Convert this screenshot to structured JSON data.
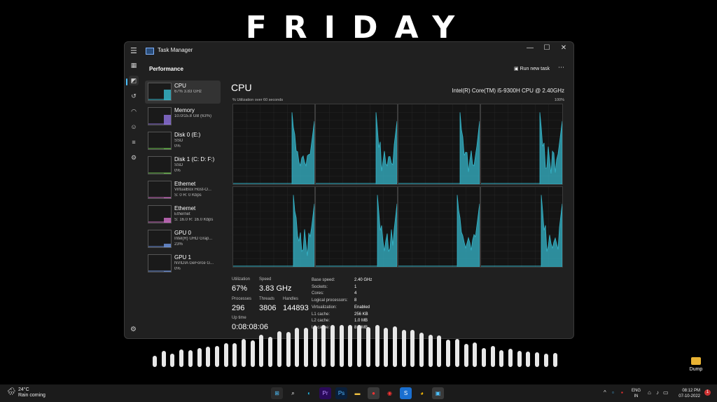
{
  "brand": "FRIDAY",
  "window": {
    "title": "Task Manager",
    "minimize": "—",
    "maximize": "☐",
    "close": "✕"
  },
  "header": {
    "title": "Performance",
    "run_new_task": "Run new task",
    "more": "⋯"
  },
  "devices": [
    {
      "name": "CPU",
      "sub1": "67% 3.83 GHz",
      "sub2": "",
      "color": "#35b5c9",
      "level": 0.67
    },
    {
      "name": "Memory",
      "sub1": "10.0/15.8 GB (63%)",
      "sub2": "",
      "color": "#8a6fd6",
      "level": 0.63
    },
    {
      "name": "Disk 0 (E:)",
      "sub1": "SSD",
      "sub2": "0%",
      "color": "#6cbf4f",
      "level": 0.0
    },
    {
      "name": "Disk 1 (C: D: F:)",
      "sub1": "SSD",
      "sub2": "0%",
      "color": "#6cbf4f",
      "level": 0.0
    },
    {
      "name": "Ethernet",
      "sub1": "VirtualBox Host-O...",
      "sub2": "S: 0 R: 0 Kbps",
      "color": "#c86bbf",
      "level": 0.0
    },
    {
      "name": "Ethernet",
      "sub1": "Ethernet",
      "sub2": "S: 16.0 R: 16.0 Kbps",
      "color": "#c86bbf",
      "level": 0.3
    },
    {
      "name": "GPU 0",
      "sub1": "Intel(R) UHD Grap...",
      "sub2": "23%",
      "color": "#6b8fd6",
      "level": 0.23
    },
    {
      "name": "GPU 1",
      "sub1": "NVIDIA GeForce G...",
      "sub2": "0%",
      "color": "#6b8fd6",
      "level": 0.0
    }
  ],
  "main": {
    "title": "CPU",
    "cpu_name": "Intel(R) Core(TM) i5-9300H CPU @ 2.40GHz",
    "util_label": "% Utilization over 60 seconds",
    "max_label": "100%",
    "graph_color": "#35b5c9"
  },
  "stats": {
    "utilization_label": "Utilization",
    "utilization": "67%",
    "speed_label": "Speed",
    "speed": "3.83 GHz",
    "processes_label": "Processes",
    "processes": "296",
    "threads_label": "Threads",
    "threads": "3806",
    "handles_label": "Handles",
    "handles": "144893",
    "uptime_label": "Up time",
    "uptime": "0:08:08:06"
  },
  "specs": [
    {
      "k": "Base speed:",
      "v": "2.40 GHz"
    },
    {
      "k": "Sockets:",
      "v": "1"
    },
    {
      "k": "Cores:",
      "v": "4"
    },
    {
      "k": "Logical processors:",
      "v": "8"
    },
    {
      "k": "Virtualization:",
      "v": "Enabled"
    },
    {
      "k": "L1 cache:",
      "v": "256 KB"
    },
    {
      "k": "L2 cache:",
      "v": "1.0 MB"
    },
    {
      "k": "L3 cache:",
      "v": "8.0 MB"
    }
  ],
  "desktop": {
    "icon": "folder-icon",
    "label": "Dump"
  },
  "taskbar": {
    "temp": "24°C",
    "weather": "Rain coming",
    "lang1": "ENG",
    "lang2": "IN",
    "time": "08:12 PM",
    "date": "07-10-2022",
    "notif": "1"
  }
}
